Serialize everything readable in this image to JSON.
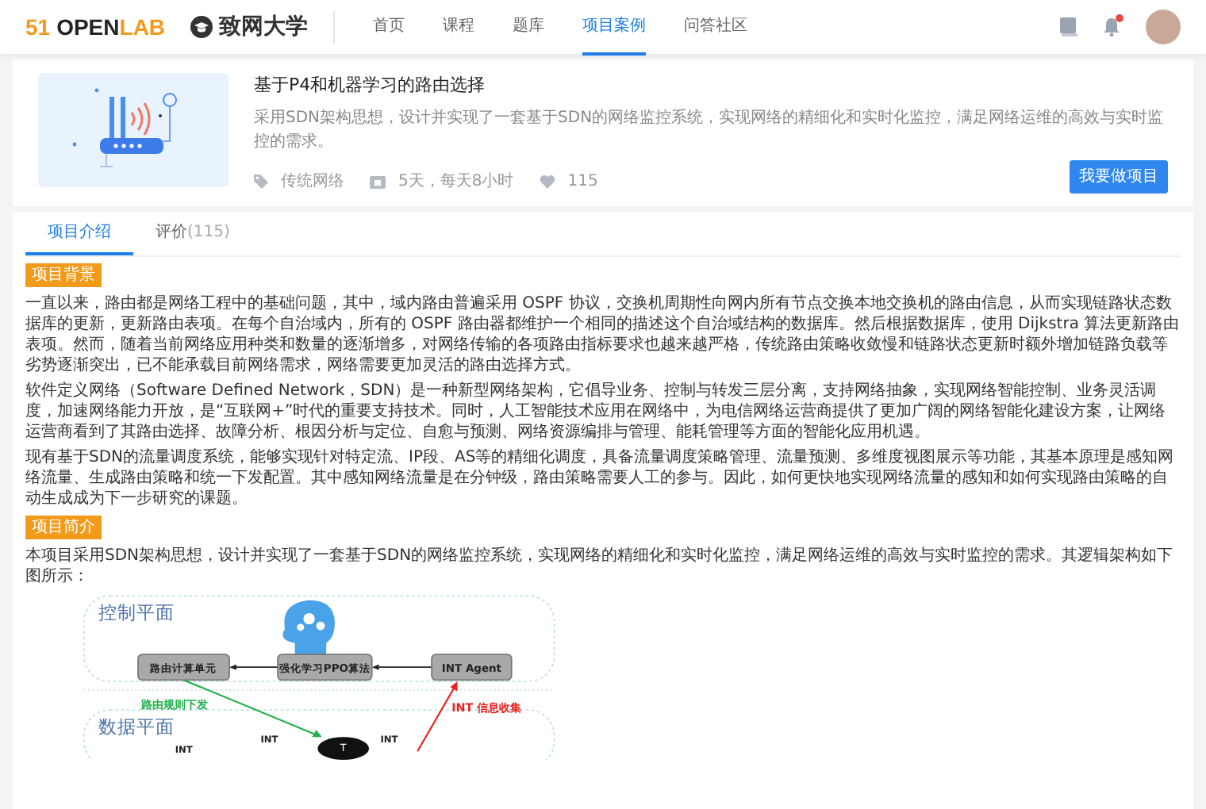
{
  "nav": {
    "brand": {
      "number": "51",
      "main": "OPEN",
      "accent": "LAB"
    },
    "school": "致网大学",
    "items": [
      {
        "label": "首页",
        "selected": false
      },
      {
        "label": "课程",
        "selected": false
      },
      {
        "label": "题库",
        "selected": false
      },
      {
        "label": "项目案例",
        "selected": true
      },
      {
        "label": "问答社区",
        "selected": false
      }
    ],
    "has_notification": true
  },
  "project": {
    "title": "基于P4和机器学习的路由选择",
    "description": "采用SDN架构思想，设计并实现了一套基于SDN的网络监控系统，实现网络的精细化和实时化监控，满足网络运维的高效与实时监控的需求。",
    "category": "传统网络",
    "duration": "5天，每天8小时",
    "likes": "115",
    "button": "我要做项目"
  },
  "tabs": [
    {
      "label": "项目介绍",
      "selected": true
    },
    {
      "label": "评价",
      "count": "(115)",
      "selected": false
    }
  ],
  "sections": [
    {
      "badge": "项目背景",
      "paragraphs": [
        "一直以来，路由都是网络工程中的基础问题，其中，域内路由普遍采用 OSPF 协议，交换机周期性向网内所有节点交换本地交换机的路由信息，从而实现链路状态数据库的更新，更新路由表项。在每个自治域内，所有的 OSPF 路由器都维护一个相同的描述这个自治域结构的数据库。然后根据数据库，使用 Dijkstra 算法更新路由表项。然而，随着当前网络应用种类和数量的逐渐增多，对网络传输的各项路由指标要求也越来越严格，传统路由策略收敛慢和链路状态更新时额外增加链路负载等劣势逐渐突出，已不能承载目前网络需求，网络需要更加灵活的路由选择方式。",
        "软件定义网络（Software Defined Network，SDN）是一种新型网络架构，它倡导业务、控制与转发三层分离，支持网络抽象，实现网络智能控制、业务灵活调度，加速网络能力开放，是“互联网+”时代的重要支持技术。同时，人工智能技术应用在网络中，为电信网络运营商提供了更加广阔的网络智能化建设方案，让网络运营商看到了其路由选择、故障分析、根因分析与定位、自愈与预测、网络资源编排与管理、能耗管理等方面的智能化应用机遇。",
        "现有基于SDN的流量调度系统，能够实现针对特定流、IP段、AS等的精细化调度，具备流量调度策略管理、流量预测、多维度视图展示等功能，其基本原理是感知网络流量、生成路由策略和统一下发配置。其中感知网络流量是在分钟级，路由策略需要人工的参与。因此，如何更快地实现网络流量的感知和如何实现路由策略的自动生成成为下一步研究的课题。"
      ]
    },
    {
      "badge": "项目简介",
      "paragraphs": [
        "本项目采用SDN架构思想，设计并实现了一套基于SDN的网络监控系统，实现网络的精细化和实时化监控，满足网络运维的高效与实时监控的需求。其逻辑架构如下图所示："
      ]
    }
  ],
  "diagram": {
    "control_plane": "控制平面",
    "nodes": [
      "路由计算单元",
      "强化学习PPO算法",
      "INT Agent"
    ],
    "down_label": "路由规则下发",
    "up_label": "INT 信息收集",
    "data_plane": "数据平面",
    "int_labels": [
      "INT",
      "INT",
      "INT"
    ],
    "switch_label": "T"
  }
}
